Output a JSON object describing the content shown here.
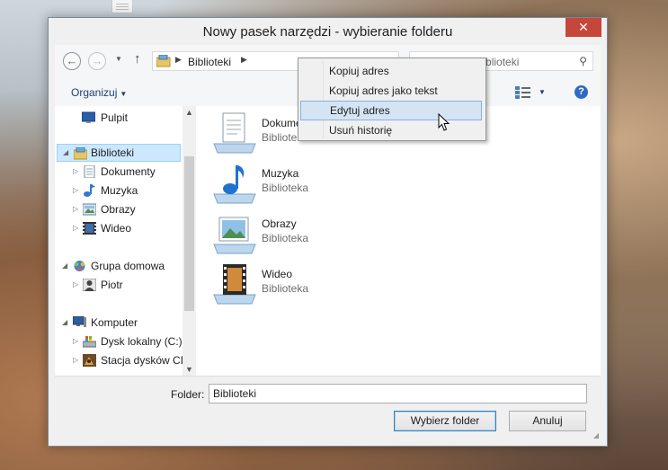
{
  "window": {
    "title": "Nowy pasek narzędzi - wybieranie folderu",
    "close_label": "✕"
  },
  "navigation": {
    "address_path": "Biblioteki",
    "search_placeholder": "Przeszukaj: Biblioteki"
  },
  "toolbar": {
    "organize_label": "Organizuj",
    "help_label": "?"
  },
  "tree": {
    "items": [
      {
        "label": "Pulpit",
        "icon": "desktop-icon"
      },
      {
        "label": "Biblioteki",
        "icon": "libraries-icon",
        "selected": true
      },
      {
        "label": "Dokumenty",
        "icon": "documents-icon"
      },
      {
        "label": "Muzyka",
        "icon": "music-icon"
      },
      {
        "label": "Obrazy",
        "icon": "pictures-icon"
      },
      {
        "label": "Wideo",
        "icon": "video-icon"
      },
      {
        "label": "Grupa domowa",
        "icon": "homegroup-icon"
      },
      {
        "label": "Piotr",
        "icon": "user-icon"
      },
      {
        "label": "Komputer",
        "icon": "computer-icon"
      },
      {
        "label": "Dysk lokalny (C:)",
        "icon": "local-disk-icon"
      },
      {
        "label": "Stacja dysków CD",
        "icon": "cd-drive-icon"
      }
    ]
  },
  "content": {
    "items": [
      {
        "name": "Dokumenty",
        "subtitle": "Biblioteka",
        "icon": "documents-library-icon"
      },
      {
        "name": "Muzyka",
        "subtitle": "Biblioteka",
        "icon": "music-library-icon"
      },
      {
        "name": "Obrazy",
        "subtitle": "Biblioteka",
        "icon": "pictures-library-icon"
      },
      {
        "name": "Wideo",
        "subtitle": "Biblioteka",
        "icon": "video-library-icon"
      }
    ]
  },
  "footer": {
    "folder_label": "Folder:",
    "folder_value": "Biblioteki",
    "select_button": "Wybierz folder",
    "cancel_button": "Anuluj"
  },
  "context_menu": {
    "items": [
      {
        "label": "Kopiuj adres"
      },
      {
        "label": "Kopiuj adres jako tekst"
      },
      {
        "label": "Edytuj adres",
        "hovered": true
      },
      {
        "label": "Usuń historię"
      }
    ]
  },
  "colors": {
    "accent": "#2d6ac8",
    "selection": "#cce8ff",
    "close": "#c7463a"
  }
}
